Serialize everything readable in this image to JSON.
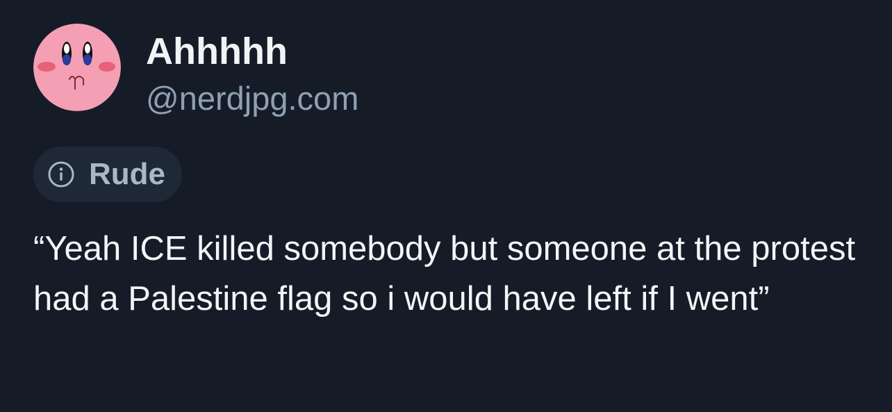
{
  "author": {
    "display_name": "Ahhhhh",
    "handle": "@nerdjpg.com",
    "avatar_icon": "kirby-face-avatar"
  },
  "moderation_label": {
    "icon": "info-icon",
    "text": "Rude"
  },
  "post": {
    "text": "“Yeah ICE killed somebody but someone at the protest had a Palestine flag so i would have left if I went”"
  },
  "colors": {
    "background": "#161c27",
    "name": "#f1f3f5",
    "handle": "#8fa0b4",
    "chip_background": "#1e2836",
    "chip_text": "#a9b7c7",
    "body_text": "#f4f5f7",
    "avatar_pink": "#f49fb3"
  }
}
